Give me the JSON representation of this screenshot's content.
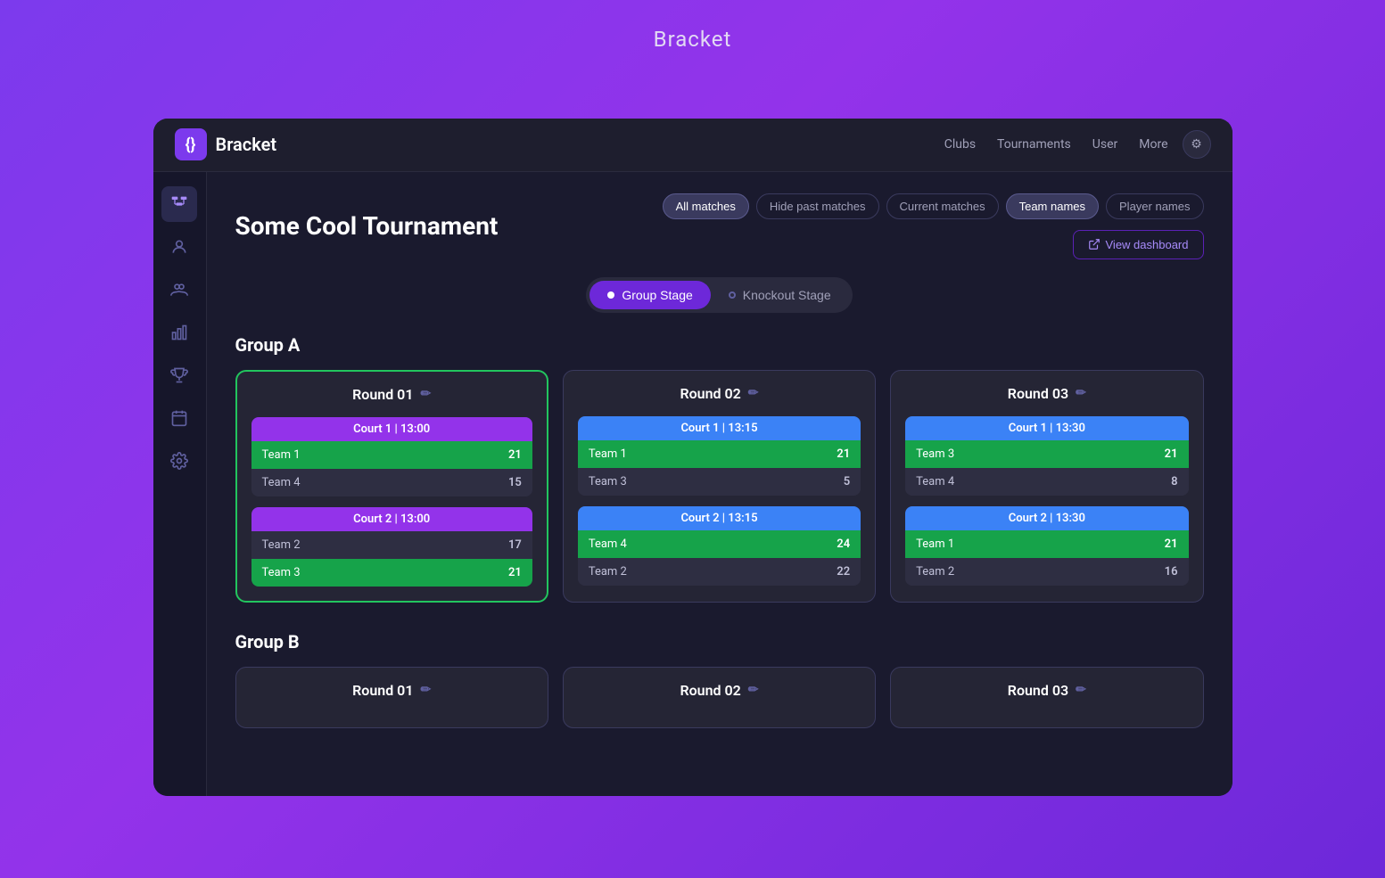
{
  "page": {
    "title": "Bracket",
    "app_name": "Bracket",
    "brand_icon": "{}"
  },
  "navbar": {
    "links": [
      "Clubs",
      "Tournaments",
      "User",
      "More"
    ],
    "settings_icon": "⚙"
  },
  "sidebar": {
    "items": [
      {
        "icon": "⊞",
        "label": "bracket-view",
        "active": true
      },
      {
        "icon": "👤",
        "label": "user-view",
        "active": false
      },
      {
        "icon": "👥",
        "label": "teams-view",
        "active": false
      },
      {
        "icon": "📊",
        "label": "stats-view",
        "active": false
      },
      {
        "icon": "🏆",
        "label": "trophy-view",
        "active": false
      },
      {
        "icon": "📅",
        "label": "calendar-view",
        "active": false
      },
      {
        "icon": "⚙",
        "label": "settings-view",
        "active": false
      }
    ]
  },
  "content": {
    "tournament_title": "Some Cool Tournament",
    "filters": [
      {
        "label": "All matches",
        "active": true
      },
      {
        "label": "Hide past matches",
        "active": false
      },
      {
        "label": "Current matches",
        "active": false
      },
      {
        "label": "Team names",
        "active": true
      },
      {
        "label": "Player names",
        "active": false
      }
    ],
    "view_dashboard_label": "View dashboard",
    "stages": [
      {
        "label": "Group Stage",
        "active": true
      },
      {
        "label": "Knockout Stage",
        "active": false
      }
    ],
    "groups": [
      {
        "name": "Group A",
        "rounds": [
          {
            "label": "Round 01",
            "active": true,
            "matches": [
              {
                "court": "Court 1 | 13:00",
                "court_color": "purple",
                "teams": [
                  {
                    "name": "Team 1",
                    "score": 21,
                    "winner": true
                  },
                  {
                    "name": "Team 4",
                    "score": 15,
                    "winner": false
                  }
                ]
              },
              {
                "court": "Court 2 | 13:00",
                "court_color": "purple",
                "teams": [
                  {
                    "name": "Team 2",
                    "score": 17,
                    "winner": false
                  },
                  {
                    "name": "Team 3",
                    "score": 21,
                    "winner": true
                  }
                ]
              }
            ]
          },
          {
            "label": "Round 02",
            "active": false,
            "matches": [
              {
                "court": "Court 1 | 13:15",
                "court_color": "blue",
                "teams": [
                  {
                    "name": "Team 1",
                    "score": 21,
                    "winner": true
                  },
                  {
                    "name": "Team 3",
                    "score": 5,
                    "winner": false
                  }
                ]
              },
              {
                "court": "Court 2 | 13:15",
                "court_color": "blue",
                "teams": [
                  {
                    "name": "Team 4",
                    "score": 24,
                    "winner": true
                  },
                  {
                    "name": "Team 2",
                    "score": 22,
                    "winner": false
                  }
                ]
              }
            ]
          },
          {
            "label": "Round 03",
            "active": false,
            "matches": [
              {
                "court": "Court 1 | 13:30",
                "court_color": "blue",
                "teams": [
                  {
                    "name": "Team 3",
                    "score": 21,
                    "winner": true
                  },
                  {
                    "name": "Team 4",
                    "score": 8,
                    "winner": false
                  }
                ]
              },
              {
                "court": "Court 2 | 13:30",
                "court_color": "blue",
                "teams": [
                  {
                    "name": "Team 1",
                    "score": 21,
                    "winner": true
                  },
                  {
                    "name": "Team 2",
                    "score": 16,
                    "winner": false
                  }
                ]
              }
            ]
          }
        ]
      },
      {
        "name": "Group B",
        "rounds": [
          {
            "label": "Round 01",
            "active": false,
            "matches": []
          },
          {
            "label": "Round 02",
            "active": false,
            "matches": []
          },
          {
            "label": "Round 03",
            "active": false,
            "matches": []
          }
        ]
      }
    ]
  }
}
